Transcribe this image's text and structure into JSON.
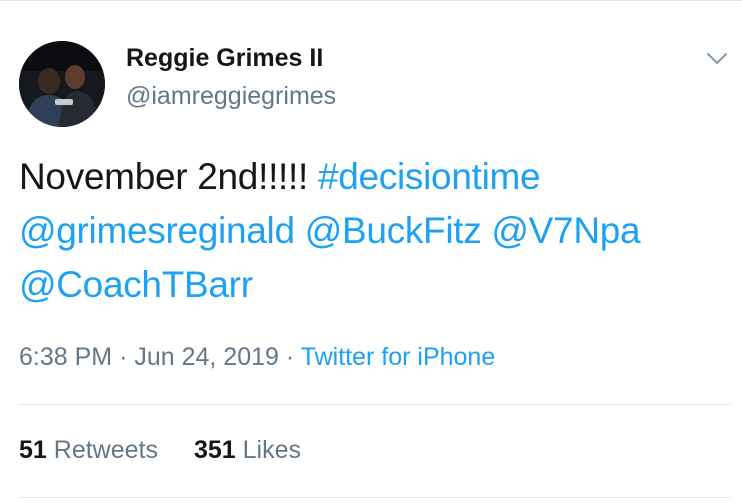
{
  "user": {
    "display_name": "Reggie Grimes II",
    "handle": "@iamreggiegrimes",
    "avatar_icon": "profile-photo"
  },
  "tweet": {
    "text": "November 2nd!!!!! ",
    "hashtag": "#decisiontime",
    "mentions": [
      "@grimesreginald",
      "@BuckFitz",
      "@V7Npa",
      "@CoachTBarr"
    ]
  },
  "meta": {
    "time": "6:38 PM",
    "separator": "·",
    "date": "Jun 24, 2019",
    "source": "Twitter for iPhone"
  },
  "stats": {
    "retweets_count": "51",
    "retweets_label": "Retweets",
    "likes_count": "351",
    "likes_label": "Likes"
  },
  "colors": {
    "link": "#1da1f2",
    "text": "#14171a",
    "secondary": "#657786",
    "divider": "#e1e8ed"
  },
  "icons": {
    "menu": "chevron-down-icon"
  }
}
